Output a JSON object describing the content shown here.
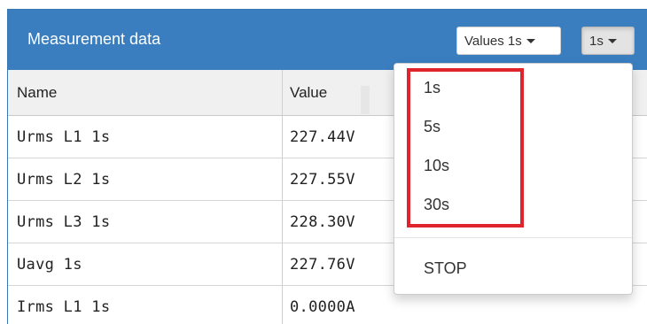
{
  "panel": {
    "title": "Measurement data",
    "values_button": {
      "label": "Values 1s",
      "icon": "caret-down-icon"
    },
    "interval_button": {
      "label": "1s",
      "icon": "caret-down-icon"
    }
  },
  "table": {
    "columns": {
      "name": "Name",
      "value": "Value"
    },
    "rows": [
      {
        "name": "Urms L1 1s",
        "value": "227.44V"
      },
      {
        "name": "Urms L2 1s",
        "value": "227.55V"
      },
      {
        "name": "Urms L3 1s",
        "value": "228.30V"
      },
      {
        "name": "Uavg 1s",
        "value": "227.76V"
      },
      {
        "name": "Irms L1 1s",
        "value": "0.0000A"
      }
    ]
  },
  "interval_menu": {
    "options": [
      "1s",
      "5s",
      "10s",
      "30s"
    ],
    "stop_label": "STOP"
  },
  "colors": {
    "header_bg": "#3a7ec0",
    "highlight": "#e0242b"
  }
}
